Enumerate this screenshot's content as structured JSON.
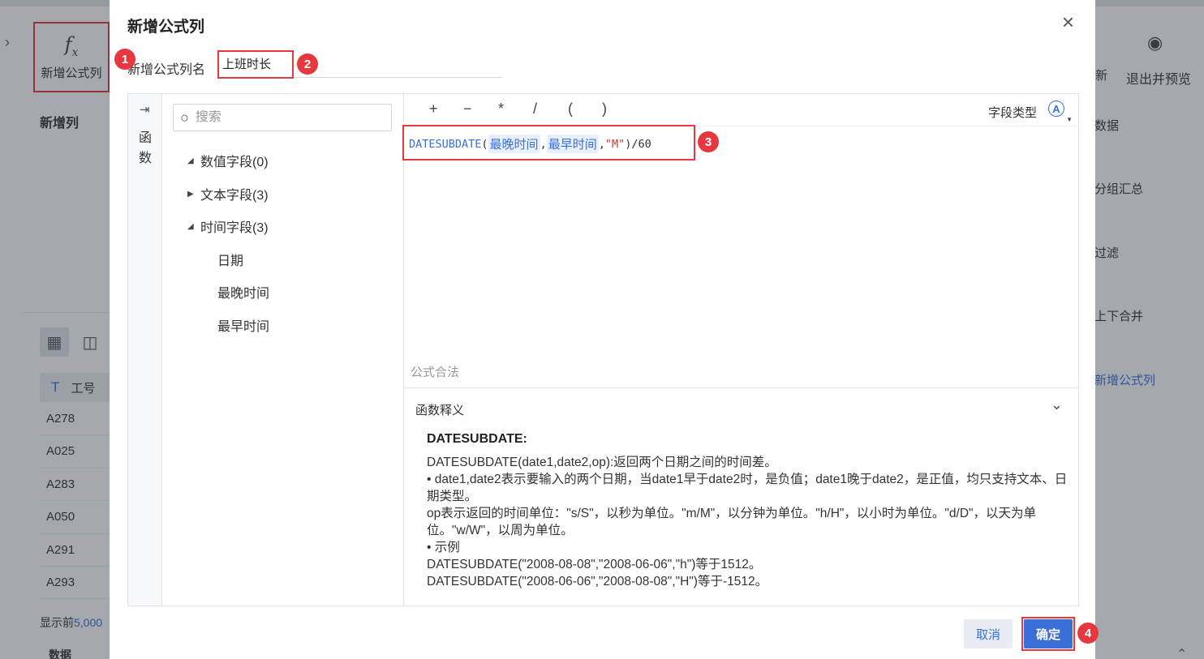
{
  "background": {
    "toolbar_fx_label": "新增公式列",
    "new_column_title": "新增列",
    "table_header": "工号",
    "table_rows": [
      "A278",
      "A025",
      "A283",
      "A050",
      "A291",
      "A293"
    ],
    "show_prefix": "显示前",
    "show_count": "5,000",
    "bottom_tab": "数据",
    "right_new_label": "新",
    "right_exit_preview": "退出并预览",
    "right_items": [
      "数据",
      "分组汇总",
      "过滤",
      "上下合并",
      "新增公式列"
    ]
  },
  "dialog": {
    "title": "新增公式列",
    "close_icon": "×",
    "name_label": "新增公式列名",
    "name_value": "上班时长",
    "side_tab_label": "函数",
    "search_placeholder": "搜索",
    "tree": [
      {
        "label": "数值字段(0)",
        "expanded": true,
        "children": []
      },
      {
        "label": "文本字段(3)",
        "expanded": false,
        "children": []
      },
      {
        "label": "时间字段(3)",
        "expanded": true,
        "children": [
          "日期",
          "最晚时间",
          "最早时间"
        ]
      }
    ],
    "operators": [
      "+",
      "−",
      "*",
      "/",
      "(",
      ")"
    ],
    "field_type_label": "字段类型",
    "field_type_icon": "A",
    "formula": {
      "fn": "DATESUBDATE",
      "open": "(",
      "arg1": "最晚时间",
      "comma1": ",",
      "arg2": "最早时间",
      "comma2": ",",
      "arg3": "\"M\"",
      "close": ")",
      "tail": "/60"
    },
    "formula_status": "公式合法",
    "func_desc_title": "函数释义",
    "func_name": "DATESUBDATE:",
    "func_desc_lines": [
      "DATESUBDATE(date1,date2,op):返回两个日期之间的时间差。",
      "•  date1,date2表示要输入的两个日期，当date1早于date2时，是负值；date1晚于date2，是正值，均只支持文本、日期类型。",
      "op表示返回的时间单位：\"s/S\"，以秒为单位。\"m/M\"，以分钟为单位。\"h/H\"，以小时为单位。\"d/D\"，以天为单位。\"w/W\"，以周为单位。",
      "•  示例",
      "DATESUBDATE(\"2008-08-08\",\"2008-06-06\",\"h\")等于1512。",
      "DATESUBDATE(\"2008-06-06\",\"2008-08-08\",\"H\")等于-1512。"
    ],
    "cancel_label": "取消",
    "ok_label": "确定"
  },
  "annotations": [
    "1",
    "2",
    "3",
    "4"
  ],
  "colors": {
    "accent": "#3a6fd8",
    "highlight": "#e6383e"
  }
}
